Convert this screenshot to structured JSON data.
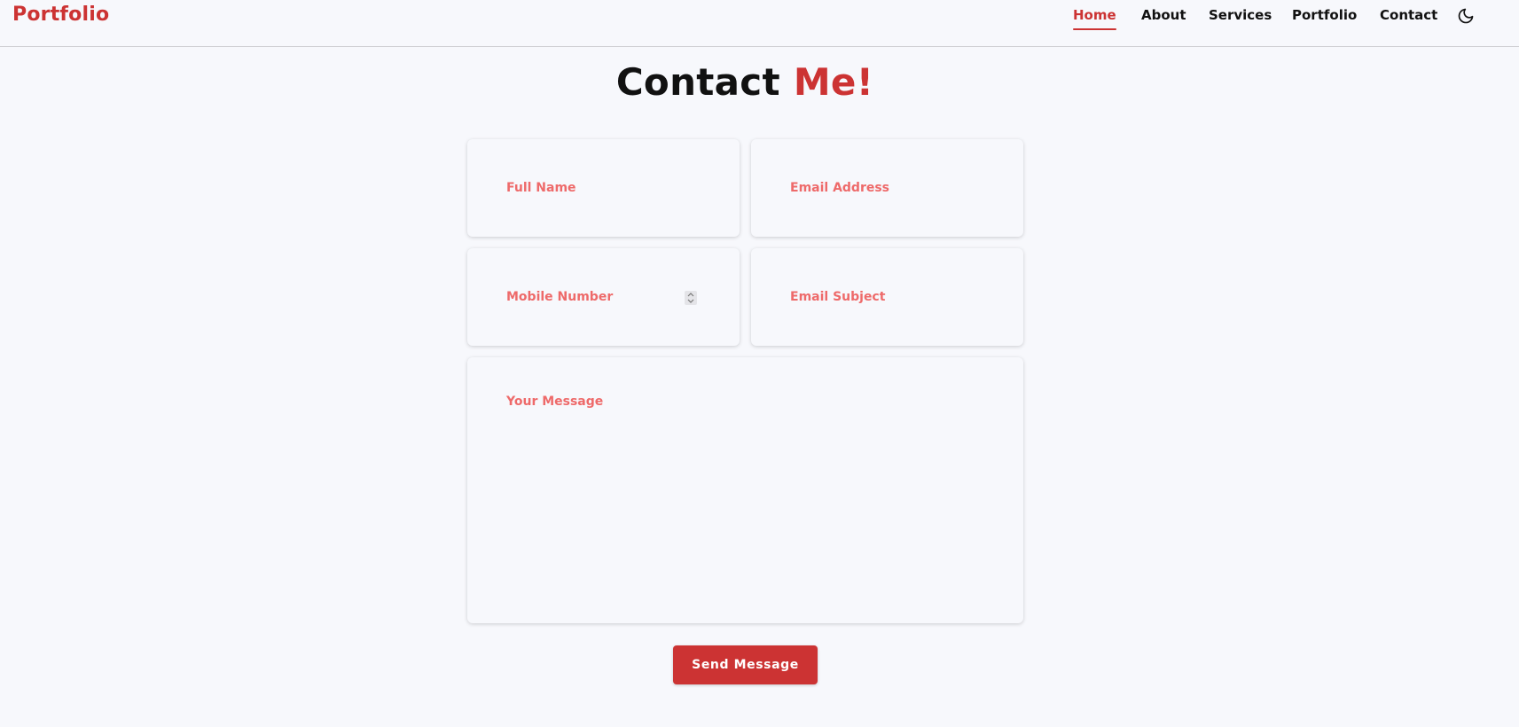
{
  "header": {
    "logo": "Portfolio",
    "nav": [
      "Home",
      "About",
      "Services",
      "Portfolio",
      "Contact"
    ],
    "active_nav": "Home",
    "theme_icon": "moon-icon"
  },
  "page": {
    "title_main": "Contact",
    "title_accent": "Me!"
  },
  "form": {
    "full_name_placeholder": "Full Name",
    "email_placeholder": "Email Address",
    "mobile_placeholder": "Mobile Number",
    "subject_placeholder": "Email Subject",
    "message_placeholder": "Your Message",
    "submit_label": "Send Message"
  },
  "colors": {
    "accent": "#cc3333",
    "placeholder": "#ee6a6a",
    "background": "#f7f8fc"
  }
}
